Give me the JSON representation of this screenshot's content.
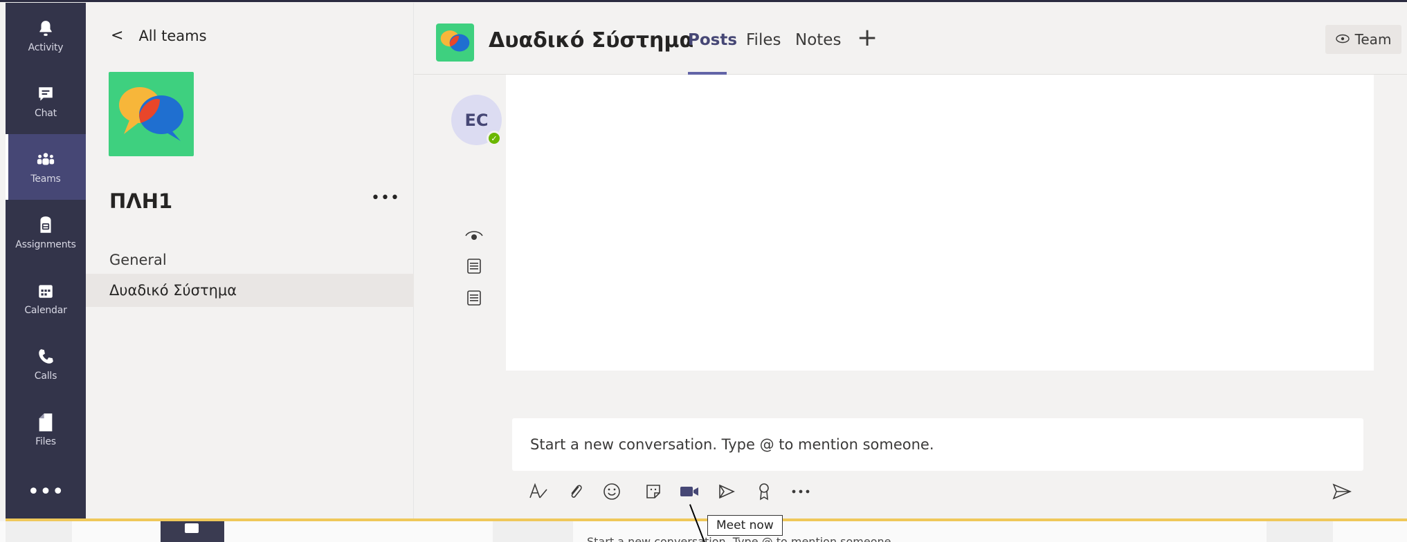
{
  "rail": {
    "items": [
      {
        "label": "Activity",
        "icon": "bell-icon"
      },
      {
        "label": "Chat",
        "icon": "chat-icon"
      },
      {
        "label": "Teams",
        "icon": "teams-icon",
        "active": true
      },
      {
        "label": "Assignments",
        "icon": "assignments-icon"
      },
      {
        "label": "Calendar",
        "icon": "calendar-icon"
      },
      {
        "label": "Calls",
        "icon": "phone-icon"
      },
      {
        "label": "Files",
        "icon": "files-icon"
      }
    ],
    "more": "•••"
  },
  "team_pane": {
    "back_label": "All teams",
    "team_name": "ΠΛΗ1",
    "more": "•••",
    "channels": [
      {
        "label": "General"
      },
      {
        "label": "Δυαδικό Σύστημα",
        "selected": true
      }
    ]
  },
  "header": {
    "channel_title": "Δυαδικό Σύστημα",
    "tabs": {
      "posts": "Posts",
      "files": "Files",
      "notes": "Notes",
      "add": "+"
    },
    "team_button": "Team"
  },
  "conversation": {
    "avatar_initials": "EC",
    "side_icons": [
      "eye-icon",
      "list-icon",
      "list-icon"
    ]
  },
  "compose": {
    "placeholder": "Start a new conversation. Type @ to mention someone.",
    "toolbar": [
      "format-icon",
      "attach-icon",
      "emoji-icon",
      "sticker-icon",
      "meet-now-icon",
      "stream-icon",
      "praise-icon",
      "more-icon"
    ]
  },
  "tooltip": {
    "text": "Meet now"
  },
  "ghost": {
    "text": "Start a new conversation. Type @ to mention someone."
  },
  "colors": {
    "rail_bg": "#33344a",
    "accent": "#6264a7",
    "team_avatar": "#3ed07f",
    "presence": "#6bb700",
    "gold_line": "#efc85a"
  }
}
